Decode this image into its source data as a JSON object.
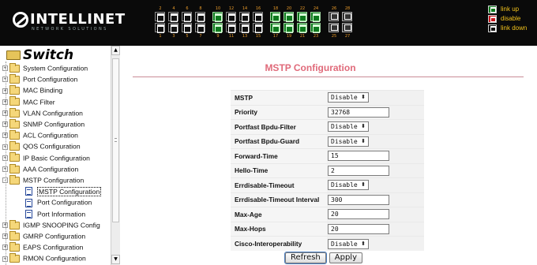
{
  "header": {
    "brand": "INTELLINET",
    "tagline": "NETWORK SOLUTIONS",
    "ports_top_numbers": [
      "2",
      "4",
      "6",
      "8",
      "10",
      "12",
      "14",
      "16",
      "18",
      "20",
      "22",
      "24",
      "26",
      "28"
    ],
    "ports_bottom_numbers": [
      "1",
      "3",
      "5",
      "7",
      "9",
      "11",
      "13",
      "15",
      "17",
      "19",
      "21",
      "23",
      "25",
      "27"
    ],
    "ports_up": [
      "9",
      "10",
      "17",
      "18",
      "19",
      "20",
      "21",
      "22",
      "23",
      "24"
    ],
    "legend": [
      {
        "label": "link up",
        "color": "#0e7a1e"
      },
      {
        "label": "disable",
        "color": "#c8161d"
      },
      {
        "label": "link down",
        "color": "#111111"
      }
    ]
  },
  "sidebar": {
    "root_label": "Switch",
    "items": [
      {
        "label": "System Configuration",
        "kind": "folder",
        "expander": "+"
      },
      {
        "label": "Port Configuration",
        "kind": "folder",
        "expander": "+"
      },
      {
        "label": "MAC Binding",
        "kind": "folder",
        "expander": "+"
      },
      {
        "label": "MAC Filter",
        "kind": "folder",
        "expander": "+"
      },
      {
        "label": "VLAN Configuration",
        "kind": "folder",
        "expander": "+"
      },
      {
        "label": "SNMP Configuration",
        "kind": "folder",
        "expander": "+"
      },
      {
        "label": "ACL Configuration",
        "kind": "folder",
        "expander": "+"
      },
      {
        "label": "QOS Configuration",
        "kind": "folder",
        "expander": "+"
      },
      {
        "label": "IP Basic Configuration",
        "kind": "folder",
        "expander": "+"
      },
      {
        "label": "AAA Configuration",
        "kind": "folder",
        "expander": "+"
      },
      {
        "label": "MSTP Configuration",
        "kind": "folder-open",
        "expander": "-"
      },
      {
        "label": "MSTP Configuration",
        "kind": "page",
        "selected": true
      },
      {
        "label": "Port Configuration",
        "kind": "page"
      },
      {
        "label": "Port Information",
        "kind": "page"
      },
      {
        "label": "IGMP SNOOPING Config",
        "kind": "folder",
        "expander": "+"
      },
      {
        "label": "GMRP Configuration",
        "kind": "folder",
        "expander": "+"
      },
      {
        "label": "EAPS Configuration",
        "kind": "folder",
        "expander": "+"
      },
      {
        "label": "RMON Configuration",
        "kind": "folder",
        "expander": "+"
      }
    ],
    "scroll_up": "▲",
    "scroll_down": "▼"
  },
  "main": {
    "title": "MSTP Configuration",
    "fields": [
      {
        "label": "MSTP",
        "type": "select",
        "value": "Disable"
      },
      {
        "label": "Priority",
        "type": "text",
        "value": "32768"
      },
      {
        "label": "Portfast Bpdu-Filter",
        "type": "select",
        "value": "Disable"
      },
      {
        "label": "Portfast Bpdu-Guard",
        "type": "select",
        "value": "Disable"
      },
      {
        "label": "Forward-Time",
        "type": "text",
        "value": "15"
      },
      {
        "label": "Hello-Time",
        "type": "text",
        "value": "2"
      },
      {
        "label": "Errdisable-Timeout",
        "type": "select",
        "value": "Disable"
      },
      {
        "label": "Errdisable-Timeout Interval",
        "type": "text",
        "value": "300"
      },
      {
        "label": "Max-Age",
        "type": "text",
        "value": "20"
      },
      {
        "label": "Max-Hops",
        "type": "text",
        "value": "20"
      },
      {
        "label": "Cisco-Interoperability",
        "type": "select",
        "value": "Disable"
      }
    ],
    "select_arrow": "⬍",
    "refresh_label": "Refresh",
    "apply_label": "Apply"
  }
}
